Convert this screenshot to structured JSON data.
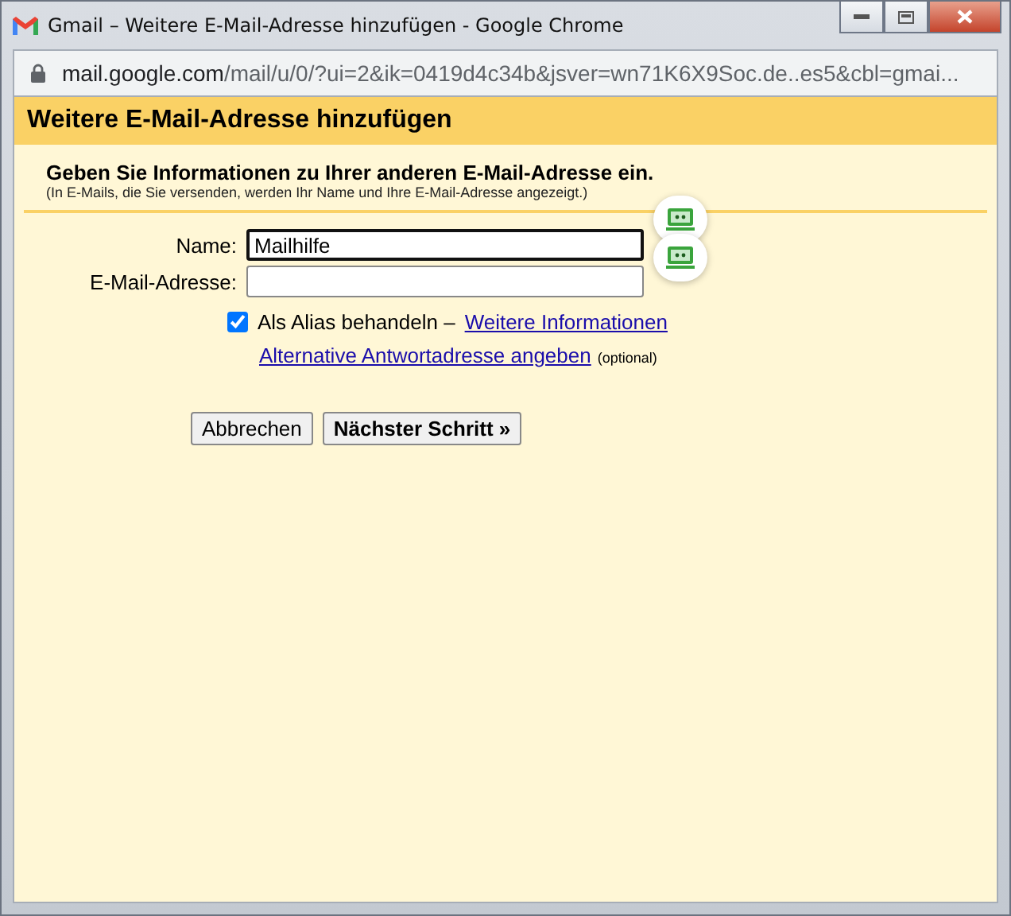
{
  "window": {
    "title": "Gmail – Weitere E-Mail-Adresse hinzufügen - Google Chrome"
  },
  "address_bar": {
    "host": "mail.google.com",
    "path": "/mail/u/0/?ui=2&ik=0419d4c34b&jsver=wn71K6X9Soc.de..es5&cbl=gmai..."
  },
  "dialog": {
    "title": "Weitere E-Mail-Adresse hinzufügen",
    "heading": "Geben Sie Informationen zu Ihrer anderen E-Mail-Adresse ein.",
    "subheading": "(In E-Mails, die Sie versenden, werden Ihr Name und Ihre E-Mail-Adresse angezeigt.)",
    "fields": [
      {
        "label": "Name:",
        "value": "Mailhilfe",
        "focused": true
      },
      {
        "label": "E-Mail-Adresse:",
        "focused": false
      }
    ],
    "alias": {
      "label": "Als Alias behandeln –",
      "checked": true,
      "link": "Weitere Informationen"
    },
    "reply_link": "Alternative Antwortadresse angeben",
    "reply_note": "(optional)",
    "buttons": [
      {
        "label": "Abbrechen",
        "primary": false
      },
      {
        "label": "Nächster Schritt »",
        "primary": true
      }
    ]
  }
}
